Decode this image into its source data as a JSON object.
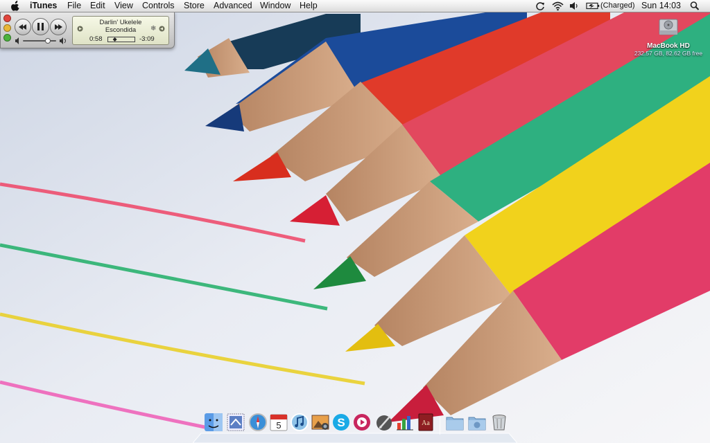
{
  "menubar": {
    "apple_icon": "apple-logo-icon",
    "app_name": "iTunes",
    "menus": [
      "File",
      "Edit",
      "View",
      "Controls",
      "Store",
      "Advanced",
      "Window",
      "Help"
    ],
    "status_icons": [
      "time-machine-sync-icon",
      "wifi-icon",
      "volume-icon",
      "battery-icon"
    ],
    "battery_status": "(Charged)",
    "clock": "Sun 14:03",
    "spotlight_icon": "spotlight-search-icon"
  },
  "mini_player": {
    "track_title": "Darlin' Ukelele",
    "artist": "Escondida",
    "elapsed": "0:58",
    "remaining": "-3:09",
    "progress_fraction": 0.24,
    "volume_fraction": 0.75
  },
  "desktop": {
    "disk_name": "MacBook HD",
    "disk_info": "232.57 GB, 82.62 GB free"
  },
  "dock": {
    "apps": [
      "finder-icon",
      "mail-stamp-icon",
      "safari-icon",
      "ical-icon",
      "itunes-icon",
      "iphoto-icon",
      "skype-icon",
      "music-app-icon",
      "pen-tool-icon",
      "chart-app-icon",
      "dictionary-icon",
      "applications-folder-icon",
      "downloads-folder-icon",
      "trash-icon"
    ],
    "ical_date": "5",
    "dictionary_label": "Aa"
  }
}
